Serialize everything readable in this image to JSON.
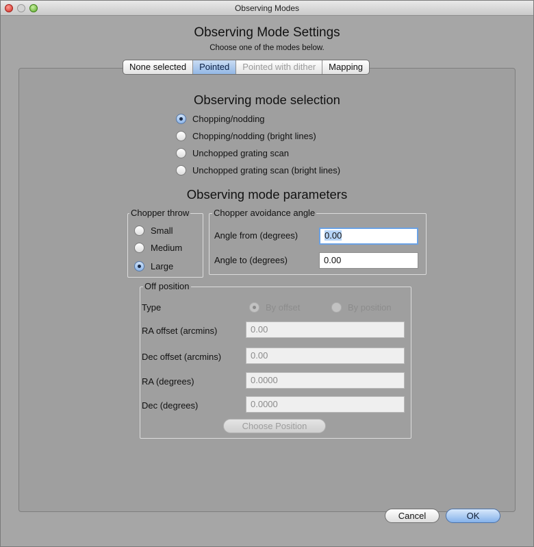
{
  "window": {
    "title": "Observing Modes"
  },
  "header": {
    "title": "Observing Mode Settings",
    "subtitle": "Choose one of the modes below."
  },
  "tabs": [
    {
      "label": "None selected",
      "state": "normal"
    },
    {
      "label": "Pointed",
      "state": "selected"
    },
    {
      "label": "Pointed with dither",
      "state": "disabled"
    },
    {
      "label": "Mapping",
      "state": "normal"
    }
  ],
  "mode_selection": {
    "title": "Observing mode selection",
    "options": [
      {
        "label": "Chopping/nodding",
        "checked": true
      },
      {
        "label": "Chopping/nodding (bright lines)",
        "checked": false
      },
      {
        "label": "Unchopped grating scan",
        "checked": false
      },
      {
        "label": "Unchopped grating scan (bright lines)",
        "checked": false
      }
    ]
  },
  "parameters": {
    "title": "Observing mode parameters",
    "chopper_throw": {
      "legend": "Chopper throw",
      "options": [
        {
          "label": "Small",
          "checked": false
        },
        {
          "label": "Medium",
          "checked": false
        },
        {
          "label": "Large",
          "checked": true
        }
      ]
    },
    "avoidance": {
      "legend": "Chopper avoidance angle",
      "angle_from_label": "Angle from (degrees)",
      "angle_from_value": "0.00",
      "angle_to_label": "Angle to (degrees)",
      "angle_to_value": "0.00"
    },
    "off_position": {
      "legend": "Off position",
      "type_label": "Type",
      "type_options": [
        {
          "label": "By offset",
          "checked": true
        },
        {
          "label": "By position",
          "checked": false
        }
      ],
      "ra_offset_label": "RA offset (arcmins)",
      "ra_offset_value": "0.00",
      "dec_offset_label": "Dec offset (arcmins)",
      "dec_offset_value": "0.00",
      "ra_label": "RA (degrees)",
      "ra_value": "0.0000",
      "dec_label": "Dec (degrees)",
      "dec_value": "0.0000",
      "choose_button": "Choose Position"
    }
  },
  "footer": {
    "cancel_label": "Cancel",
    "ok_label": "OK"
  },
  "colors": {
    "window_bg": "#a6a6a6",
    "panel_bg": "#9f9f9f",
    "selected_tab": "#93b8e6",
    "focus_ring": "#6aa1e4"
  }
}
